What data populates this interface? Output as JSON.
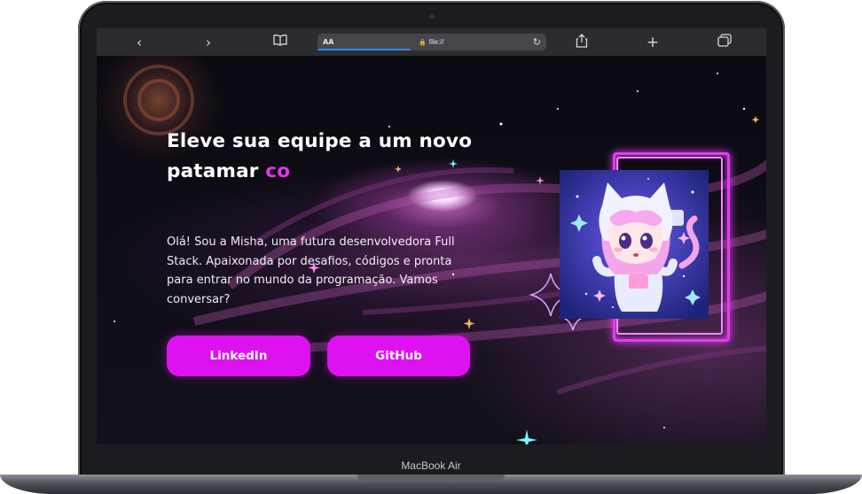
{
  "device": {
    "label": "MacBook Air"
  },
  "browser": {
    "reader_label": "AA",
    "url": "file://",
    "icons": {
      "back": "chevron-left-icon",
      "forward": "chevron-right-icon",
      "bookmarks": "book-icon",
      "lock": "lock-icon",
      "reload": "reload-icon",
      "share": "share-icon",
      "new_tab": "plus-icon",
      "tabs": "tabs-icon"
    }
  },
  "hero": {
    "headline": "Eleve sua equipe a um novo patamar",
    "typed_text": "co",
    "intro": "Olá! Sou a Misha, uma futura desenvolvedora Full Stack. Apaixonada por desafios, códigos e pronta para entrar no mundo da programação. Vamos conversar?"
  },
  "buttons": {
    "linkedin": "LinkedIn",
    "github": "GitHub"
  },
  "colors": {
    "accent": "#de12f0",
    "neon_frame": "#e13cf0",
    "background": "#0b0a12"
  }
}
